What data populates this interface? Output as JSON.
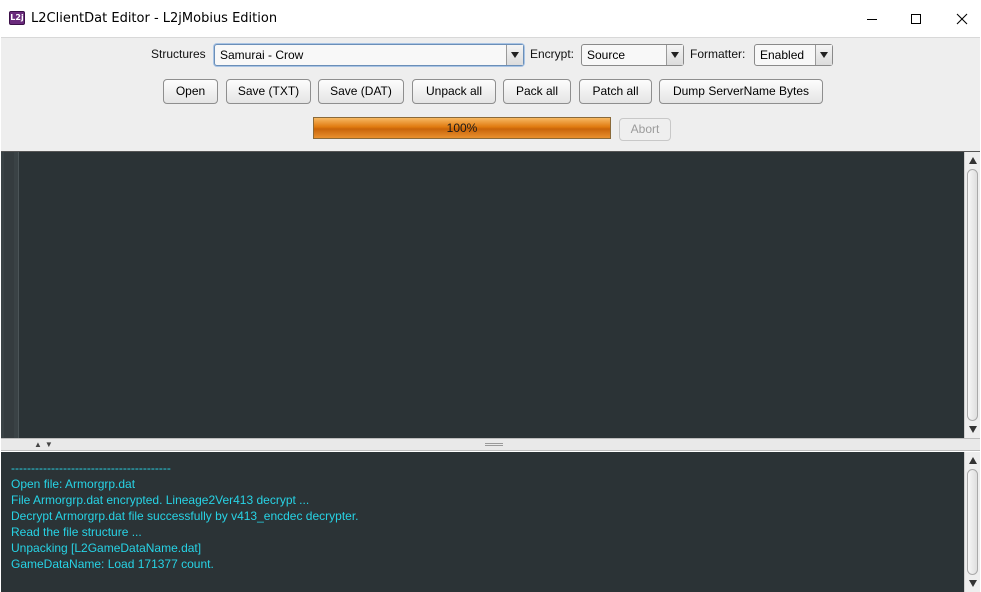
{
  "window": {
    "icon_text": "L2j",
    "title": "L2ClientDat Editor - L2jMobius Edition"
  },
  "toolbar": {
    "structures_label": "Structures",
    "structures_value": "Samurai - Crow",
    "encrypt_label": "Encrypt:",
    "encrypt_value": "Source",
    "formatter_label": "Formatter:",
    "formatter_value": "Enabled",
    "buttons": {
      "open": "Open",
      "save_txt": "Save (TXT)",
      "save_dat": "Save (DAT)",
      "unpack_all": "Unpack all",
      "pack_all": "Pack all",
      "patch_all": "Patch all",
      "dump_servername": "Dump ServerName Bytes"
    },
    "progress_text": "100%",
    "progress_value": 1.0,
    "abort": "Abort"
  },
  "colors": {
    "editor_bg": "#2b3336",
    "console_text": "#27d3e5",
    "progress_fill": "#e07a0f"
  },
  "icons": {
    "minimize": "minimize-icon",
    "maximize": "maximize-icon",
    "close": "close-icon",
    "dropdown": "chevron-down-icon"
  },
  "console": {
    "lines": [
      "----------------------------------------",
      "Open file: Armorgrp.dat",
      "File Armorgrp.dat encrypted. Lineage2Ver413 decrypt ...",
      "Decrypt Armorgrp.dat file successfully by v413_encdec decrypter.",
      "Read the file structure ...",
      "Unpacking [L2GameDataName.dat]",
      "GameDataName: Load 171377 count."
    ]
  }
}
